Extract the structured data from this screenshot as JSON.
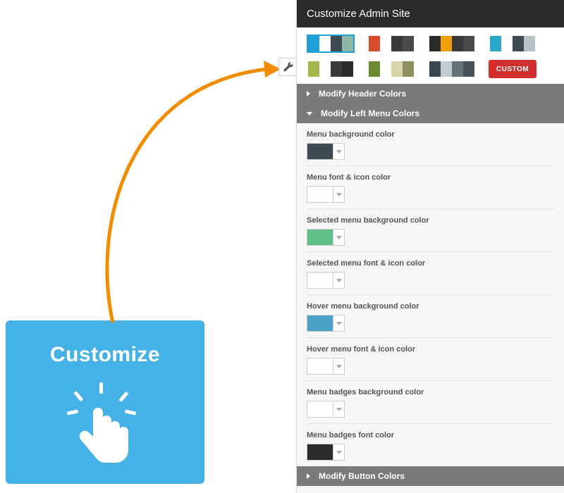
{
  "card": {
    "title": "Customize"
  },
  "panel": {
    "title": "Customize Admin Site",
    "palettes": [
      {
        "selected": true,
        "colors": [
          "#1fa0d8",
          "#ffffff",
          "#3f4b52",
          "#8fb7a8"
        ]
      },
      {
        "selected": false,
        "colors": [
          "#d94b2b",
          "#ffffff",
          "#3a3a3a",
          "#4a4a4a"
        ]
      },
      {
        "selected": false,
        "colors": [
          "#2b2b2b",
          "#f2a007",
          "#3a3a3a",
          "#4a4a4a"
        ]
      },
      {
        "selected": false,
        "colors": [
          "#2aa7c9",
          "#ffffff",
          "#3d4a52",
          "#b8c2c7"
        ]
      },
      {
        "selected": false,
        "colors": [
          "#a1b84a",
          "#ffffff",
          "#3a3a3a",
          "#2b2b2b"
        ]
      },
      {
        "selected": false,
        "colors": [
          "#6a8a2f",
          "#ffffff",
          "#d8d3a8",
          "#8f9060"
        ]
      },
      {
        "selected": false,
        "colors": [
          "#3a4750",
          "#c2cbd0",
          "#64727a",
          "#455058"
        ]
      }
    ],
    "custom_label": "CUSTOM",
    "sections": {
      "header": {
        "label": "Modify Header Colors",
        "expanded": false
      },
      "leftmenu": {
        "label": "Modify Left Menu Colors",
        "expanded": true,
        "fields": [
          {
            "label": "Menu background color",
            "color": "#3f4b52"
          },
          {
            "label": "Menu font & icon color",
            "color": "#ffffff"
          },
          {
            "label": "Selected menu background color",
            "color": "#5fbf87"
          },
          {
            "label": "Selected menu font & icon color",
            "color": "#ffffff"
          },
          {
            "label": "Hover menu background color",
            "color": "#4aa3c7"
          },
          {
            "label": "Hover menu font & icon color",
            "color": "#ffffff"
          },
          {
            "label": "Menu badges background color",
            "color": "#ffffff"
          },
          {
            "label": "Menu badges font color",
            "color": "#2b2b2b"
          }
        ]
      },
      "button": {
        "label": "Modify Button Colors",
        "expanded": false
      }
    }
  }
}
